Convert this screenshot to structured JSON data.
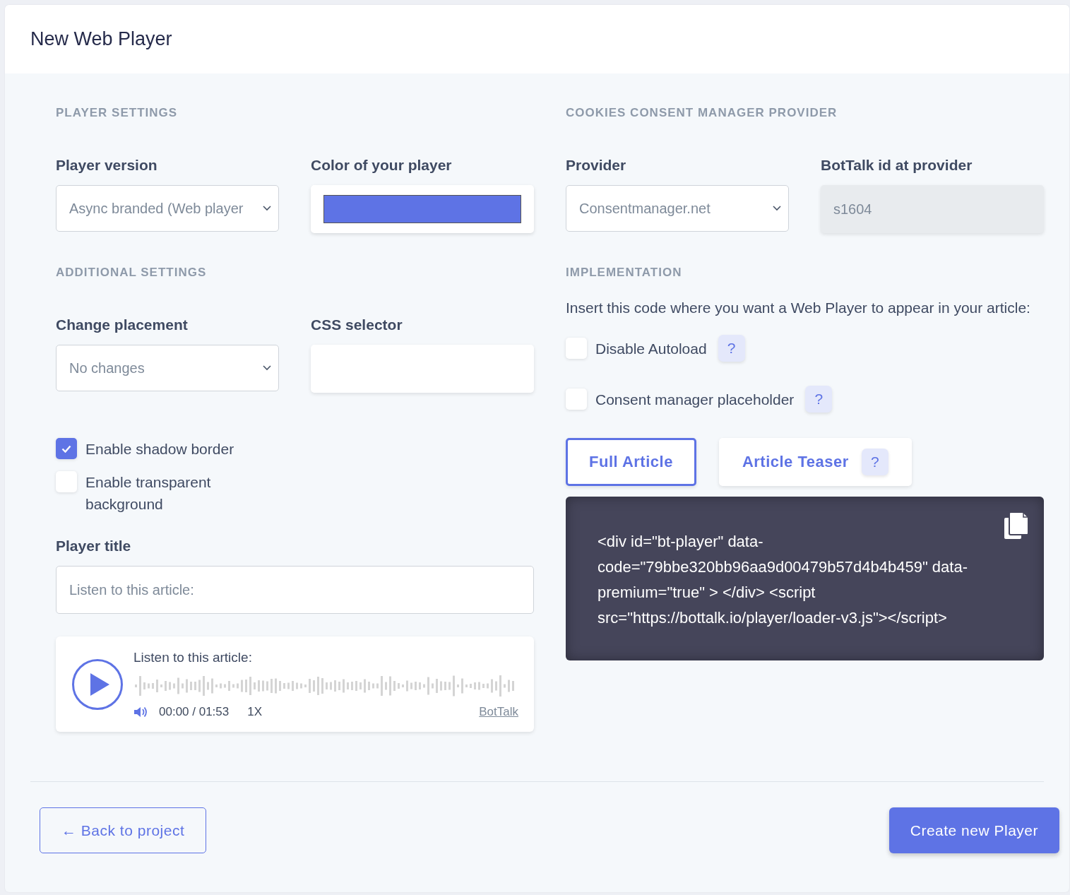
{
  "page": {
    "title": "New Web Player"
  },
  "player_settings": {
    "heading": "PLAYER SETTINGS",
    "player_version": {
      "label": "Player version",
      "value": "Async branded (Web player"
    },
    "color": {
      "label": "Color of your player",
      "color": "#5e73e5"
    }
  },
  "additional_settings": {
    "heading": "ADDITIONAL SETTINGS",
    "change_placement": {
      "label": "Change placement",
      "value": "No changes"
    },
    "css_selector": {
      "label": "CSS selector"
    },
    "checkboxes": [
      {
        "label": "Enable shadow border",
        "checked": true
      },
      {
        "label": "Enable transparent background",
        "checked": false
      }
    ],
    "player_title": {
      "label": "Player title",
      "placeholder": "Listen to this article:"
    }
  },
  "preview": {
    "title": "Listen to this article:",
    "time": "00:00 / 01:53",
    "speed": "1X",
    "brand": "BotTalk"
  },
  "consent": {
    "heading": "COOKIES CONSENT MANAGER PROVIDER",
    "provider": {
      "label": "Provider",
      "value": "Consentmanager.net"
    },
    "bottalk_id": {
      "label": "BotTalk id at provider",
      "value": "s1604",
      "disabled": true
    }
  },
  "implementation": {
    "heading": "IMPLEMENTATION",
    "instructions": "Insert this code where you want a Web Player to appear in your article:",
    "checkboxes": [
      {
        "label": "Disable Autoload",
        "checked": false,
        "help": "?"
      },
      {
        "label": "Consent manager placeholder",
        "checked": false,
        "help": "?"
      }
    ],
    "tabs": [
      {
        "label": "Full Article",
        "selected": true
      },
      {
        "label": "Article Teaser",
        "selected": false,
        "help": "?"
      }
    ],
    "code": "<div id=\"bt-player\" data-code=\"79bbe320bb96aa9d00479b57d4b4b459\" data-premium=\"true\" > </div> <script src=\"https://bottalk.io/player/loader-v3.js\"></script>"
  },
  "footer": {
    "back_button": "← Back to project",
    "create_button": "Create new Player"
  }
}
